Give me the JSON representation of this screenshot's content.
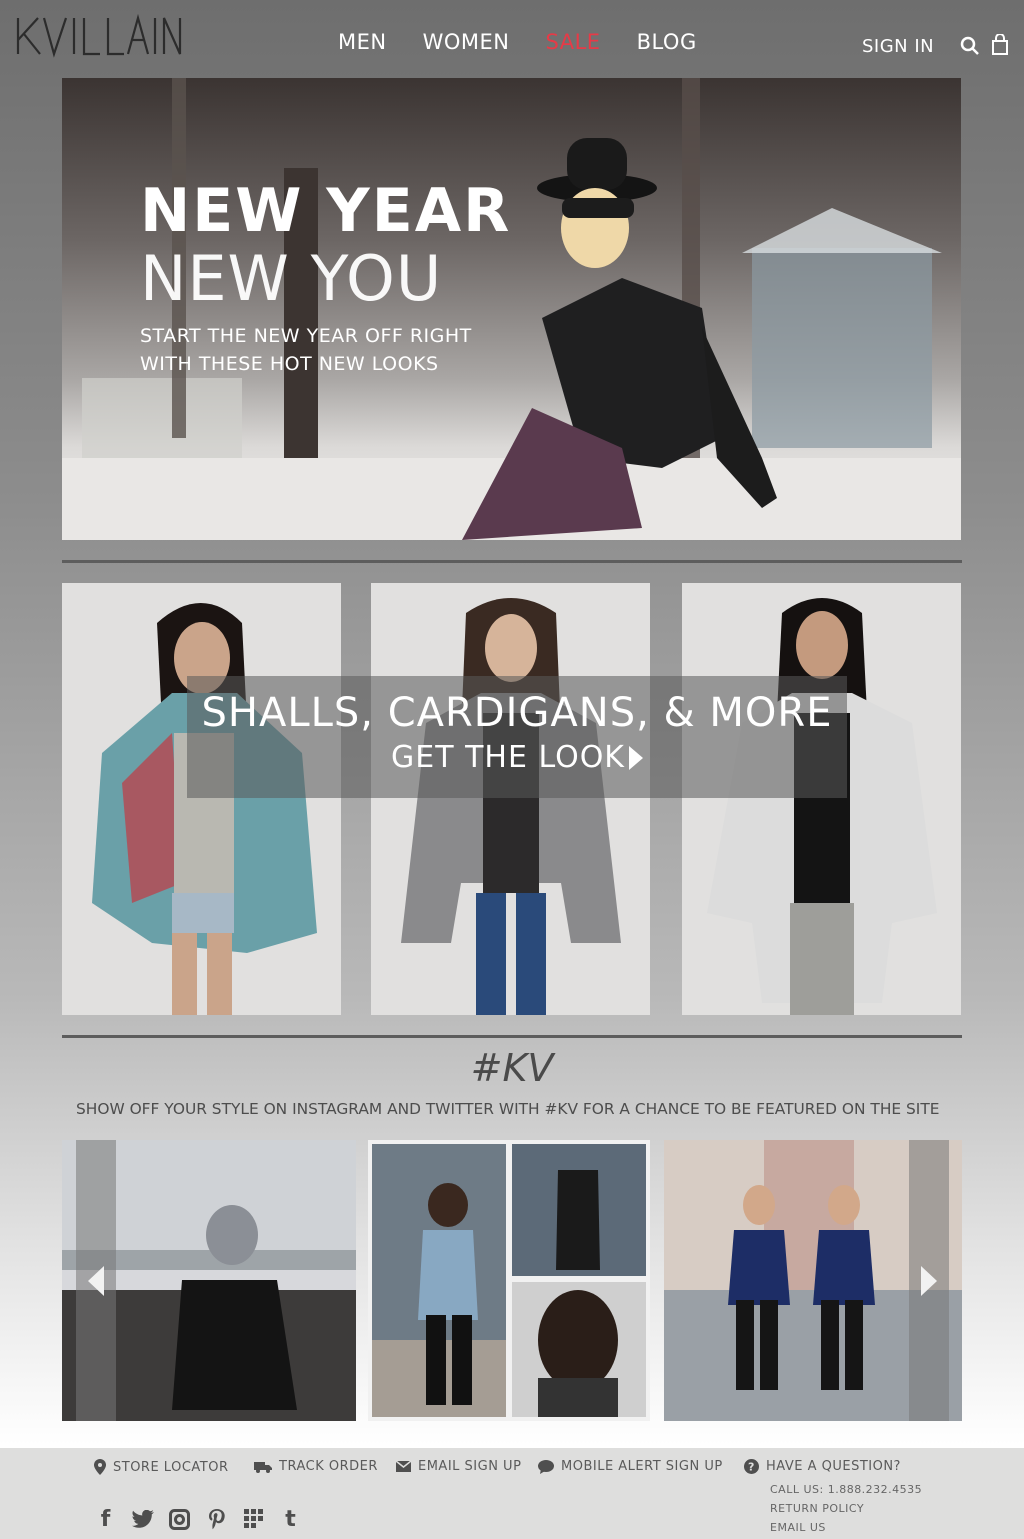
{
  "header": {
    "logo_text": "KVILLAIN",
    "nav": [
      "MEN",
      "WOMEN",
      "SALE",
      "BLOG"
    ],
    "signin": "SIGN IN",
    "sale_color": "#e63a47"
  },
  "hero": {
    "title1": "NEW YEAR",
    "title2": "NEW YOU",
    "sub1": "START THE NEW YEAR OFF RIGHT",
    "sub2": "WITH THESE HOT NEW LOOKS"
  },
  "promo": {
    "title": "SHALLS, CARDIGANS, & MORE",
    "cta": "GET THE LOOK"
  },
  "kv": {
    "title": "#KV",
    "subtitle": "SHOW OFF YOUR STYLE ON INSTAGRAM AND TWITTER WITH #KV FOR A CHANCE TO BE FEATURED ON THE SITE"
  },
  "footer": {
    "links": [
      "STORE LOCATOR",
      "TRACK ORDER",
      "EMAIL SIGN UP",
      "MOBILE ALERT SIGN UP",
      "HAVE A QUESTION?"
    ],
    "call": "CALL US: 1.888.232.4535",
    "return_policy": "RETURN POLICY",
    "email_us": "EMAIL US",
    "social": [
      "facebook-icon",
      "twitter-icon",
      "instagram-icon",
      "pinterest-icon",
      "foursquare-icon",
      "tumblr-icon"
    ]
  }
}
